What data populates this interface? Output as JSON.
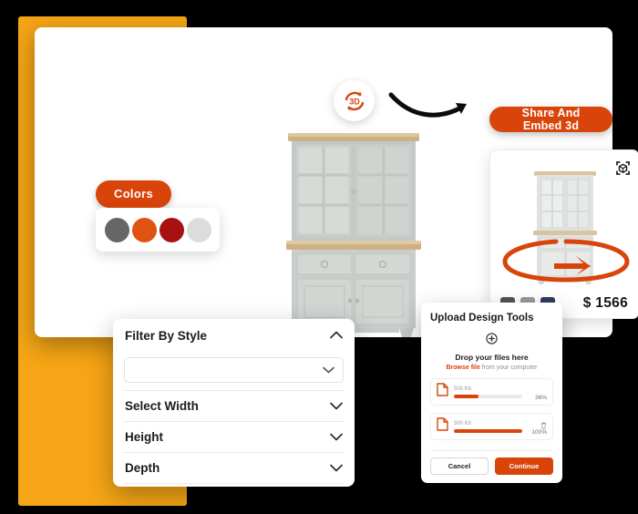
{
  "theme": {
    "accent_orange": "#d9440a",
    "accent_yellow": "#f5a515",
    "background": "#000000",
    "card_background": "#ffffff"
  },
  "colors_panel": {
    "pill_label": "Colors",
    "swatches": [
      {
        "name": "dark-gray",
        "hex": "#666666"
      },
      {
        "name": "orange",
        "hex": "#df5310"
      },
      {
        "name": "dark-red",
        "hex": "#a81111"
      },
      {
        "name": "light-gray",
        "hex": "#dcdcdc"
      }
    ]
  },
  "viewer": {
    "badge_icon": "rotate-3d-icon",
    "badge_label": "3D",
    "arrow_icon": "curved-arrow-icon",
    "product_icon": "display-cabinet-image"
  },
  "share": {
    "button_label": "Share And Embed 3d"
  },
  "preview_card": {
    "ar_icon": "ar-cube-icon",
    "orbit_icon": "orbit-rotation-arrow-icon",
    "product_icon": "display-cabinet-thumbnail",
    "swatches": [
      {
        "name": "dark-gray",
        "hex": "#545454"
      },
      {
        "name": "mid-gray",
        "hex": "#9a9a9a"
      },
      {
        "name": "navy",
        "hex": "#2e3c61"
      }
    ],
    "price": "$ 1566"
  },
  "filter_panel": {
    "sections": [
      {
        "label": "Filter By Style",
        "state": "expanded",
        "chevron": "chevron-up-icon"
      },
      {
        "label": "Select Width",
        "state": "collapsed",
        "chevron": "chevron-down-icon"
      },
      {
        "label": "Height",
        "state": "collapsed",
        "chevron": "chevron-down-icon"
      },
      {
        "label": "Depth",
        "state": "collapsed",
        "chevron": "chevron-down-icon"
      }
    ],
    "style_select": {
      "value": "",
      "placeholder": ""
    }
  },
  "upload_dialog": {
    "title": "Upload Design Tools",
    "dropzone": {
      "icon": "upload-plus-icon",
      "headline": "Drop your files here",
      "browse_link": "Browse file",
      "sub_text": " from your computer"
    },
    "files": [
      {
        "icon": "file-icon",
        "size": "500 Kb",
        "percent_label": "36%",
        "percent": 36,
        "deletable": false
      },
      {
        "icon": "file-icon",
        "size": "500 Kb",
        "percent_label": "100%",
        "percent": 100,
        "deletable": true,
        "delete_icon": "trash-icon"
      }
    ],
    "cancel_label": "Cancel",
    "continue_label": "Continue"
  }
}
